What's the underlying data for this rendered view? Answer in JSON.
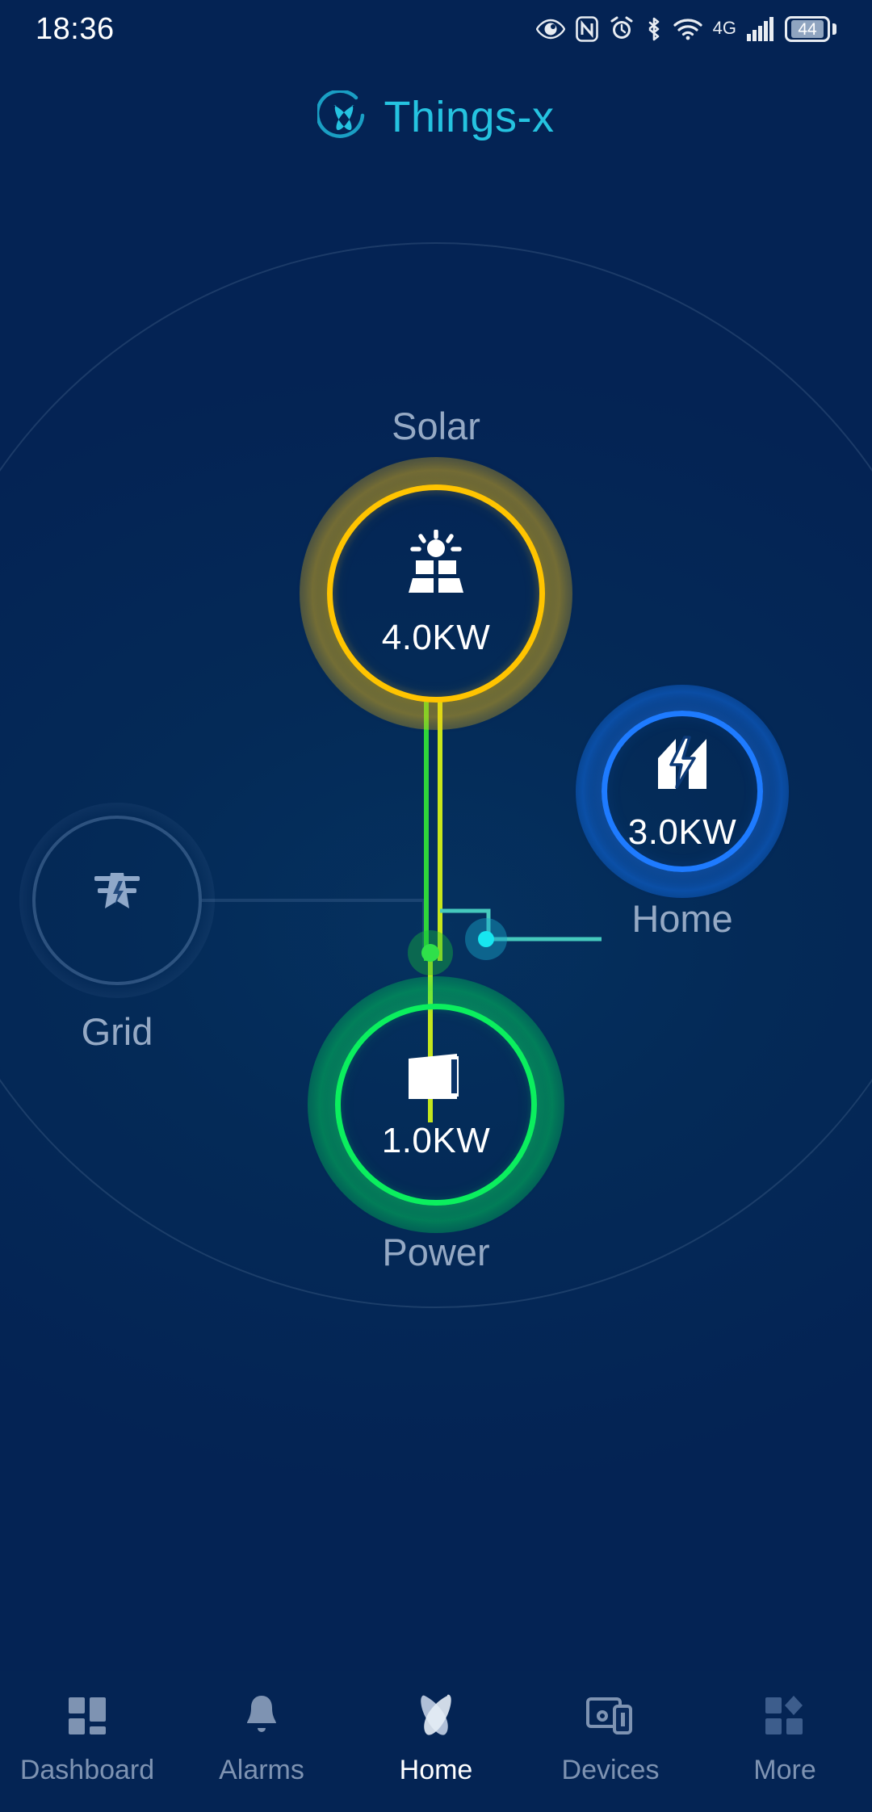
{
  "status_bar": {
    "time": "18:36",
    "battery_percent": "44",
    "network": "4G",
    "icons": [
      "eye-care-icon",
      "nfc-icon",
      "alarm-clock-icon",
      "bluetooth-icon",
      "wifi-icon",
      "signal-bars-icon",
      "battery-icon"
    ]
  },
  "brand": {
    "name": "Things-x",
    "accent_color": "#25c3e0",
    "logo_icon": "things-x-logo-icon"
  },
  "theme": {
    "background": "#042454",
    "solar_color": "#ffc400",
    "home_color": "#1e7bff",
    "power_color": "#0bef5e",
    "grid_inactive_color": "#7ea0cd",
    "flow_green": "#8fe321",
    "flow_cyan": "#3fd8c8",
    "label_color": "#95a9c4"
  },
  "energy_flow": {
    "nodes": {
      "solar": {
        "label": "Solar",
        "value": "4.0KW",
        "icon": "solar-panel-icon",
        "active": true,
        "color": "#ffc400"
      },
      "grid": {
        "label": "Grid",
        "value": "",
        "icon": "power-pylon-icon",
        "active": false,
        "color": "#7ea0cd"
      },
      "home": {
        "label": "Home",
        "value": "3.0KW",
        "icon": "house-bolt-icon",
        "active": true,
        "color": "#1e7bff"
      },
      "power": {
        "label": "Power",
        "value": "1.0KW",
        "icon": "battery-pack-icon",
        "active": true,
        "color": "#0bef5e"
      }
    },
    "links": [
      {
        "from": "solar",
        "to": "junction",
        "color": "#8fe321",
        "active": true
      },
      {
        "from": "junction",
        "to": "home",
        "color": "#3fd8c8",
        "active": true
      },
      {
        "from": "junction",
        "to": "power",
        "color": "#a8e619",
        "active": true
      },
      {
        "from": "grid",
        "to": "junction",
        "color": "#7ea0cd",
        "active": false
      }
    ]
  },
  "bottom_nav": {
    "active": "Home",
    "items": [
      {
        "label": "Dashboard",
        "icon": "dashboard-grid-icon"
      },
      {
        "label": "Alarms",
        "icon": "bell-icon"
      },
      {
        "label": "Home",
        "icon": "things-x-home-icon"
      },
      {
        "label": "Devices",
        "icon": "devices-monitor-icon"
      },
      {
        "label": "More",
        "icon": "more-diamond-grid-icon"
      }
    ]
  }
}
